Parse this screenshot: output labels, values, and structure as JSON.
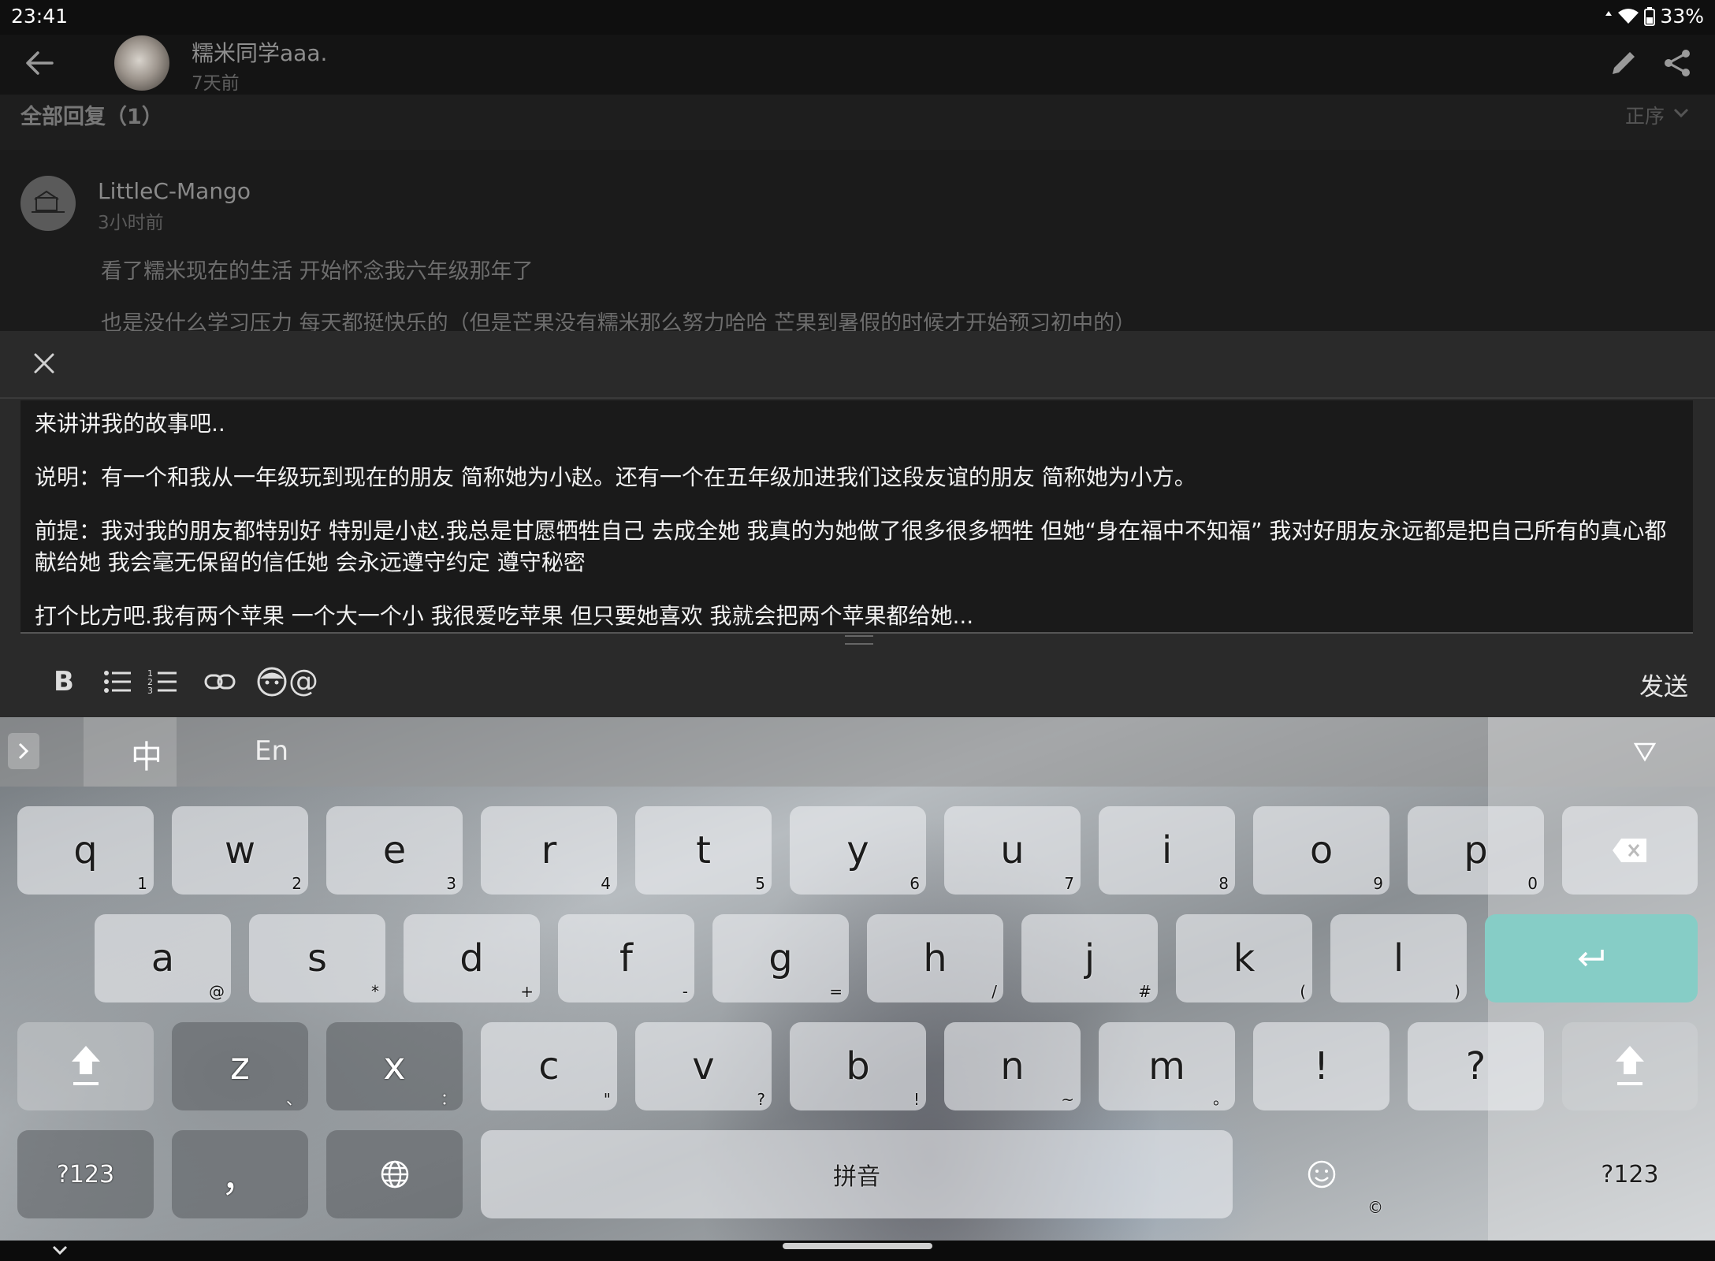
{
  "status_bar": {
    "time": "23:41",
    "battery": "33%"
  },
  "header": {
    "author": "糯米同学aaa.",
    "time": "7天前"
  },
  "replies": {
    "title": "全部回复（1）",
    "sort": "正序"
  },
  "comment": {
    "author": "LittleC-Mango",
    "time": "3小时前",
    "lines": [
      "看了糯米现在的生活 开始怀念我六年级那年了",
      "也是没什么学习压力 每天都挺快乐的（但是芒果没有糯米那么努力哈哈 芒果到暑假的时候才开始预习初中的）"
    ]
  },
  "composer": {
    "paragraphs": [
      "来讲讲我的故事吧..",
      "说明：有一个和我从一年级玩到现在的朋友 简称她为小赵。还有一个在五年级加进我们这段友谊的朋友 简称她为小方。",
      "前提：我对我的朋友都特别好 特别是小赵.我总是甘愿牺牲自己 去成全她 我真的为她做了很多很多牺牲 但她“身在福中不知福” 我对好朋友永远都是把自己所有的真心都献给她 我会毫无保留的信任她 会永远遵守约定 遵守秘密",
      "打个比方吧.我有两个苹果 一个大一个小 我很爱吃苹果 但只要她喜欢 我就会把两个苹果都给她..."
    ],
    "send_label": "发送",
    "toolbar_icons": [
      "bold-icon",
      "bullet-list-icon",
      "numbered-list-icon",
      "link-icon",
      "emoji-icon",
      "mention-icon"
    ],
    "bold_label": "B",
    "mention_label": "@"
  },
  "keyboard": {
    "lang_cn": "中",
    "lang_en": "En",
    "row1": [
      {
        "k": "q",
        "h": "1"
      },
      {
        "k": "w",
        "h": "2"
      },
      {
        "k": "e",
        "h": "3"
      },
      {
        "k": "r",
        "h": "4"
      },
      {
        "k": "t",
        "h": "5"
      },
      {
        "k": "y",
        "h": "6"
      },
      {
        "k": "u",
        "h": "7"
      },
      {
        "k": "i",
        "h": "8"
      },
      {
        "k": "o",
        "h": "9"
      },
      {
        "k": "p",
        "h": "0"
      }
    ],
    "row2": [
      {
        "k": "a",
        "h": "@"
      },
      {
        "k": "s",
        "h": "*"
      },
      {
        "k": "d",
        "h": "+"
      },
      {
        "k": "f",
        "h": "-"
      },
      {
        "k": "g",
        "h": "="
      },
      {
        "k": "h",
        "h": "/"
      },
      {
        "k": "j",
        "h": "#"
      },
      {
        "k": "k",
        "h": "("
      },
      {
        "k": "l",
        "h": ")"
      }
    ],
    "row3": [
      {
        "k": "z",
        "h": "、"
      },
      {
        "k": "x",
        "h": "："
      },
      {
        "k": "c",
        "h": "\""
      },
      {
        "k": "v",
        "h": "?"
      },
      {
        "k": "b",
        "h": "!"
      },
      {
        "k": "n",
        "h": "~"
      },
      {
        "k": "m",
        "h": "。"
      },
      {
        "k": "!",
        "h": ""
      },
      {
        "k": "?",
        "h": ""
      }
    ],
    "symbols_label": "?123",
    "comma_label": "，",
    "space_label": "拼音",
    "emoji_hint": "©",
    "colors": {
      "enter": "#86cdc6"
    }
  }
}
